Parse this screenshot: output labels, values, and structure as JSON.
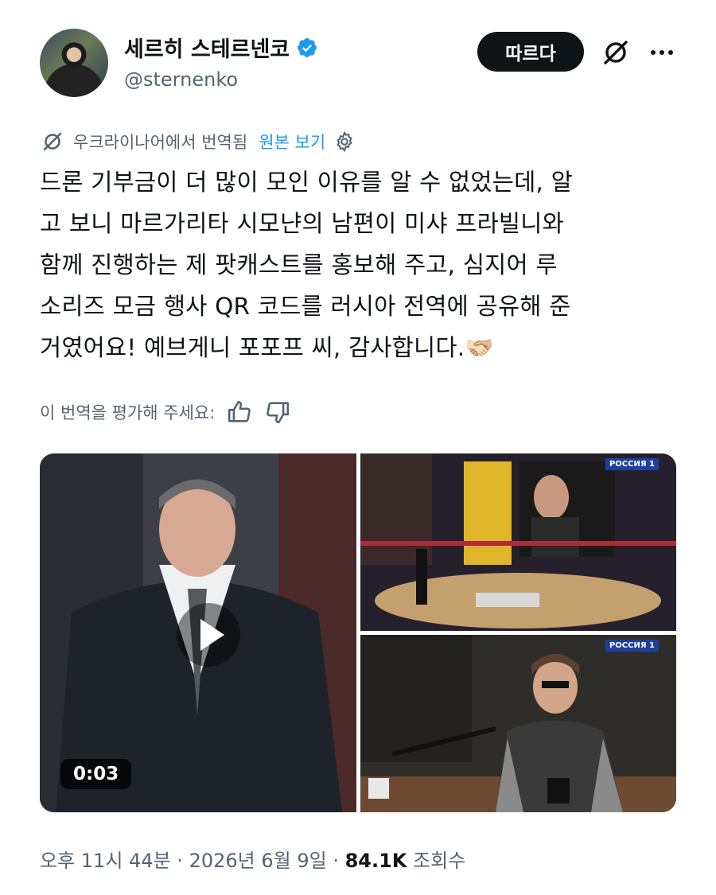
{
  "header": {
    "display_name": "세르히 스테르넨코",
    "handle": "@sternenko",
    "follow_label": "따르다",
    "verified_color": "#1d9bf0",
    "icons": [
      "grok-icon",
      "more-icon"
    ]
  },
  "translation": {
    "notice": "우크라이나어에서 번역됨",
    "show_original": "원본 보기"
  },
  "tweet": {
    "lines": [
      "드론 기부금이 더 많이 모인 이유를 알 수 없었는데, 알",
      "고 보니 마르가리타 시모냔의 남편이 미샤 프라빌니와",
      "함께 진행하는 제 팟캐스트를 홍보해 주고, 심지어 루",
      "소리즈 모금 행사 QR 코드를 러시아 전역에 공유해 준",
      "거였어요! 예브게니 포포프 씨, 감사합니다.🫱🏻‍🫲🏼"
    ]
  },
  "rating": {
    "prompt": "이 번역을 평가해 주세요:"
  },
  "media": {
    "video_duration": "0:03",
    "tv_logo_top": "РОССИЯ 1",
    "tv_logo_bottom": "РОССИЯ 1"
  },
  "meta": {
    "time": "오후 11시 44분",
    "date": "2026년 6월 9일",
    "views_count": "84.1K",
    "views_label": "조회수"
  },
  "colors": {
    "link": "#1d9bf0",
    "secondary_text": "#536471",
    "primary_text": "#0f1419"
  }
}
